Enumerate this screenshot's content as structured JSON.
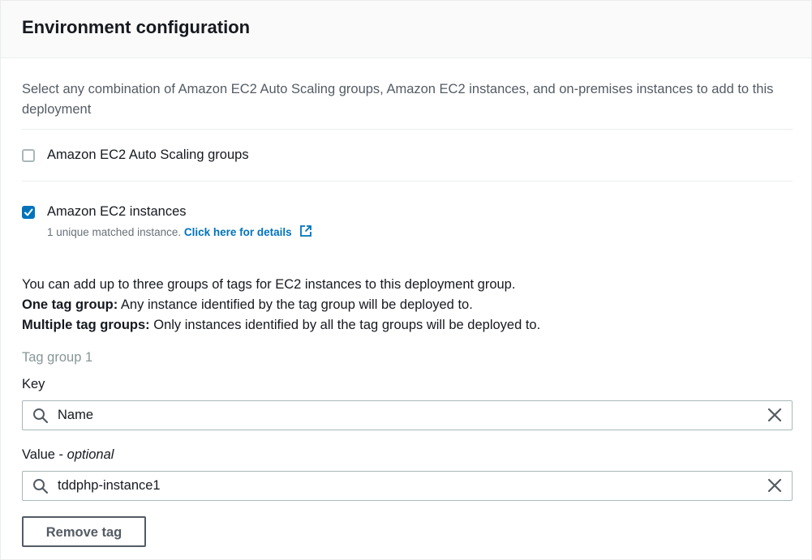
{
  "header": {
    "title": "Environment configuration"
  },
  "description": "Select any combination of Amazon EC2 Auto Scaling groups, Amazon EC2 instances, and on-premises instances to add to this deployment",
  "options": {
    "auto_scaling": {
      "label": "Amazon EC2 Auto Scaling groups",
      "checked": false
    },
    "ec2_instances": {
      "label": "Amazon EC2 instances",
      "checked": true,
      "note": "1 unique matched instance.",
      "link": "Click here for details",
      "link_icon": "external-link-icon"
    }
  },
  "info": {
    "line1": "You can add up to three groups of tags for EC2 instances to this deployment group.",
    "line2_bold": "One tag group:",
    "line2_rest": " Any instance identified by the tag group will be deployed to.",
    "line3_bold": "Multiple tag groups:",
    "line3_rest": " Only instances identified by all the tag groups will be deployed to."
  },
  "tag_group": {
    "title": "Tag group 1",
    "key_label": "Key",
    "key_value": "Name",
    "value_label": "Value - ",
    "value_optional": "optional",
    "value_value": "tddphp-instance1",
    "remove_label": "Remove tag"
  },
  "colors": {
    "accent": "#0073bb",
    "text": "#16191f",
    "muted": "#687078"
  }
}
